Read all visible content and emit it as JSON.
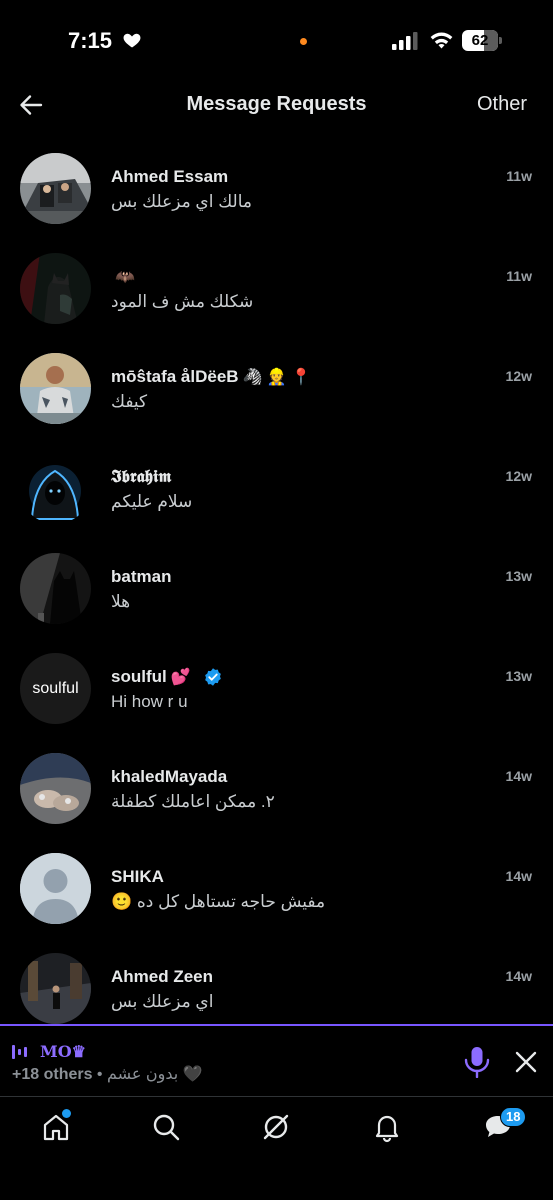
{
  "status_bar": {
    "time": "7:15",
    "battery": "62"
  },
  "header": {
    "title": "Message Requests",
    "other_label": "Other"
  },
  "requests": [
    {
      "name": "Ahmed Essam",
      "emoji_suffix": "",
      "message": "مالك اي مزعلك بس",
      "time": "11w",
      "avatar": "photo-car"
    },
    {
      "name": "",
      "emoji_suffix": "🦇",
      "message": "شكلك مش ف المود",
      "time": "11w",
      "avatar": "photo-dark-hero"
    },
    {
      "name": "mōŝtafa ålDëeB",
      "emoji_suffix": "🦓 👷 📍",
      "message": "كيفك",
      "time": "12w",
      "avatar": "photo-person"
    },
    {
      "name": "𝕴𝖇𝖗𝖆𝖍𝖎𝖒",
      "emoji_suffix": "",
      "message": "سلام عليكم",
      "time": "12w",
      "avatar": "photo-hacker"
    },
    {
      "name": "batman",
      "emoji_suffix": "",
      "message": "هلا",
      "time": "13w",
      "avatar": "photo-batman"
    },
    {
      "name": "soulful",
      "emoji_suffix": "💕",
      "message": "Hi how r u",
      "time": "13w",
      "avatar": "soulful-logo",
      "avatar_text": "soulful",
      "verified": true
    },
    {
      "name": "khaledMayada",
      "emoji_suffix": "",
      "message": "٢. ممكن اعاملك كطفلة",
      "time": "14w",
      "avatar": "photo-hands"
    },
    {
      "name": "SHIKA",
      "emoji_suffix": "",
      "message": "مفيش حاجه تستاهل كل ده 🙂",
      "time": "14w",
      "avatar": "default-avatar"
    },
    {
      "name": "Ahmed Zeen",
      "emoji_suffix": "",
      "message": "اي مزعلك بس",
      "time": "14w",
      "avatar": "photo-street"
    }
  ],
  "space": {
    "host": "MO♛",
    "others": "+18 others",
    "separator": " • ",
    "title": "بدون عشم 🖤"
  },
  "nav": {
    "messages_badge": "18"
  },
  "colors": {
    "accent_purple": "#7856ff",
    "twitter_blue": "#1d9bf0",
    "background": "#000000"
  }
}
